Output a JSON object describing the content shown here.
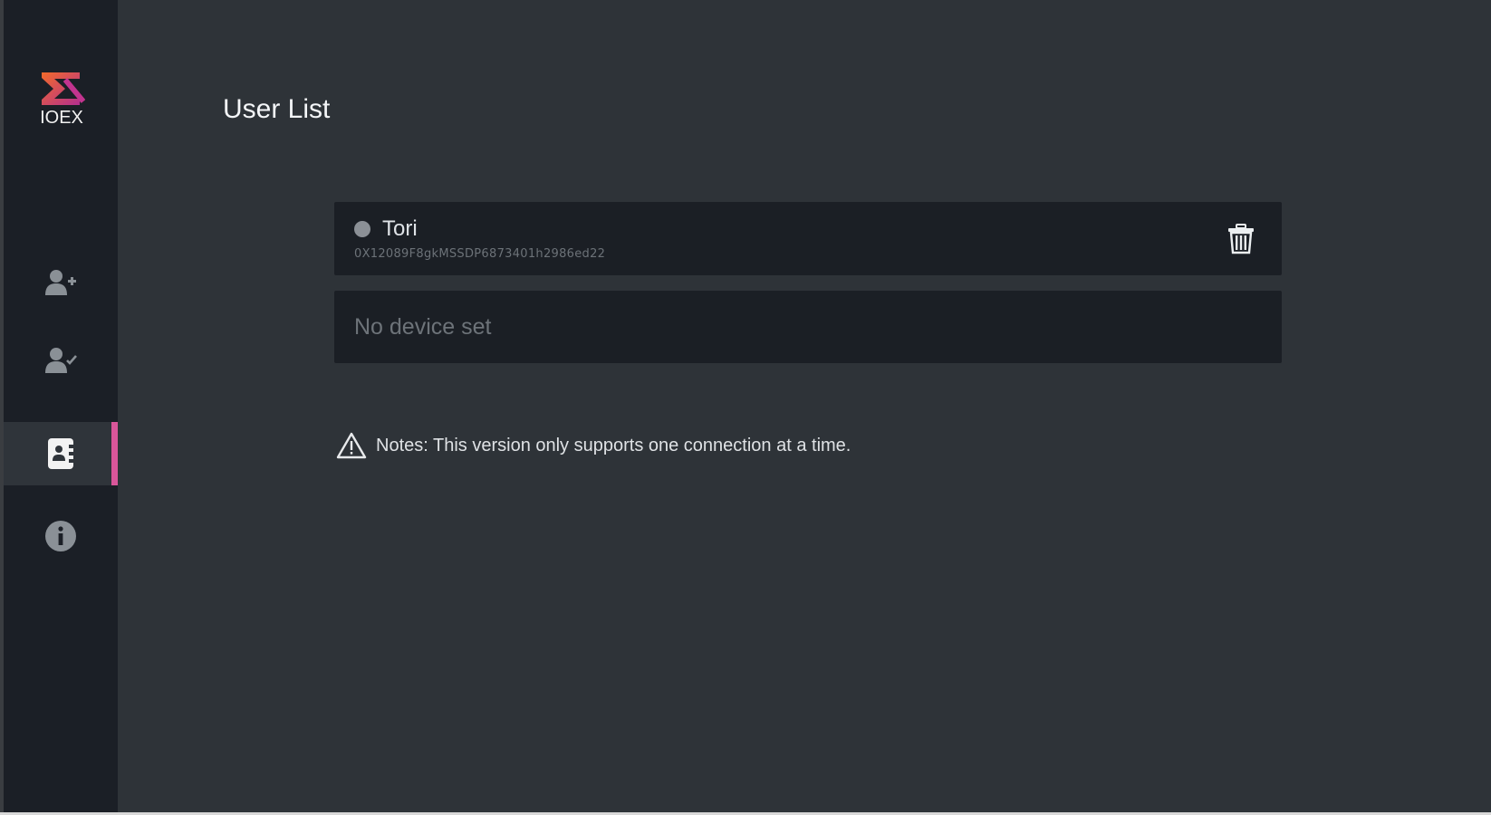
{
  "brand": {
    "logo_text": "IOEX",
    "accent_orange": "#f05a28",
    "accent_magenta": "#b8308f"
  },
  "sidebar": {
    "items": [
      {
        "name": "add-user",
        "icon": "user-plus-icon",
        "active": false
      },
      {
        "name": "verify-user",
        "icon": "user-check-icon",
        "active": false
      },
      {
        "name": "user-list",
        "icon": "address-book-icon",
        "active": true
      },
      {
        "name": "info",
        "icon": "info-icon",
        "active": false
      }
    ],
    "active_indicator_color": "#d9569a"
  },
  "main": {
    "title": "User List",
    "user": {
      "name": "Tori",
      "address": "0X12089F8gkMSSDP6873401h2986ed22",
      "status_color": "#8b9096",
      "delete_icon": "trash-icon"
    },
    "device": {
      "status_text": "No device set"
    },
    "notes": {
      "icon": "warning-icon",
      "text": "Notes: This version only supports one connection at a time."
    }
  }
}
